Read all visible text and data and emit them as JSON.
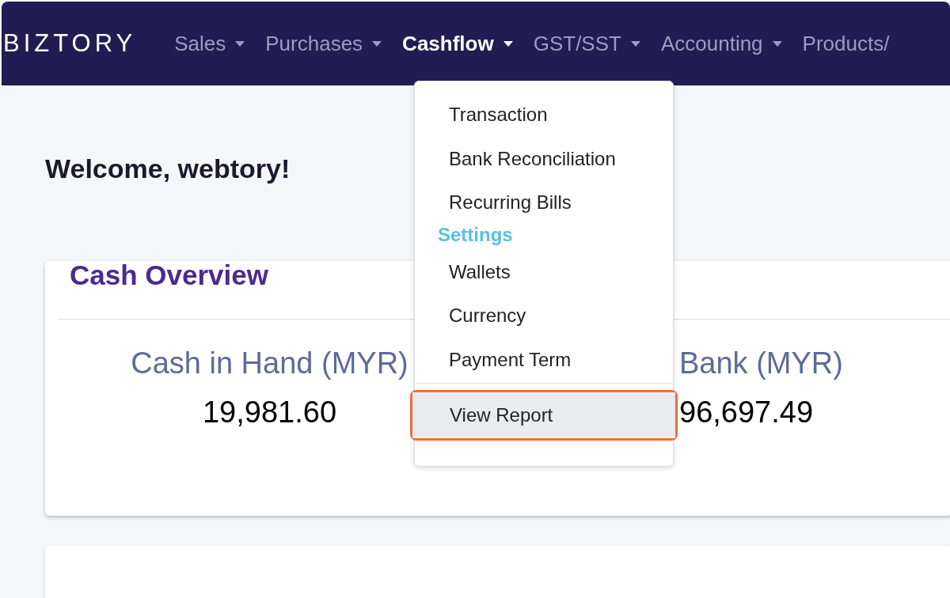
{
  "navbar": {
    "logo": "BIZTORY",
    "items": [
      {
        "label": "Sales",
        "selected": false,
        "caret": true
      },
      {
        "label": "Purchases",
        "selected": false,
        "caret": true
      },
      {
        "label": "Cashflow",
        "selected": true,
        "caret": true
      },
      {
        "label": "GST/SST",
        "selected": false,
        "caret": true
      },
      {
        "label": "Accounting",
        "selected": false,
        "caret": true
      },
      {
        "label": "Products/",
        "selected": false,
        "caret": false
      }
    ]
  },
  "dropdown": {
    "items": [
      {
        "kind": "item",
        "label": "Transaction",
        "highlighted": false
      },
      {
        "kind": "item",
        "label": "Bank Reconciliation",
        "highlighted": false
      },
      {
        "kind": "item",
        "label": "Recurring Bills",
        "highlighted": false
      },
      {
        "kind": "header",
        "label": "Settings"
      },
      {
        "kind": "item",
        "label": "Wallets",
        "highlighted": false
      },
      {
        "kind": "item",
        "label": "Currency",
        "highlighted": false
      },
      {
        "kind": "item",
        "label": "Payment Term",
        "highlighted": false
      },
      {
        "kind": "divider"
      },
      {
        "kind": "item",
        "label": "View Report",
        "highlighted": true
      }
    ]
  },
  "welcome": "Welcome, webtory!",
  "cash_overview": {
    "title": "Cash Overview",
    "stats": [
      {
        "label": "Cash in Hand (MYR)",
        "value": "19,981.60"
      },
      {
        "label": "Bank (MYR)",
        "value": "96,697.49"
      }
    ]
  }
}
